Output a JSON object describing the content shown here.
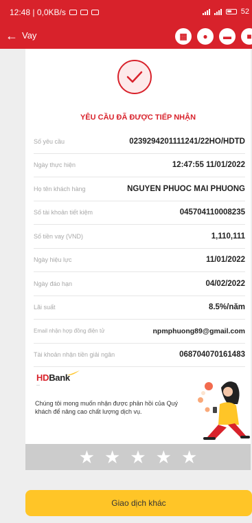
{
  "status_bar": {
    "time_speed": "12:48 | 0,0KB/s",
    "battery": "52"
  },
  "app_bar": {
    "back_icon": "arrow-left-icon",
    "title": "Vay",
    "icons": [
      "qr-icon",
      "bell-icon",
      "chat-icon",
      "gift-icon"
    ]
  },
  "success": {
    "title": "YÊU CẦU ĐÃ ĐƯỢC TIẾP NHẬN",
    "icon": "check-icon"
  },
  "details": [
    {
      "label": "Số yêu cầu",
      "value": "0239294201111241/22HO/HDTD"
    },
    {
      "label": "Ngày thực hiện",
      "value": "12:47:55 11/01/2022"
    },
    {
      "label": "Họ tên khách hàng",
      "value": "NGUYEN PHUOC MAI PHUONG"
    },
    {
      "label": "Số tài khoản tiết kiệm",
      "value": "045704110008235"
    },
    {
      "label": "Số tiền vay (VND)",
      "value": "1,110,111"
    },
    {
      "label": "Ngày hiệu lực",
      "value": "11/01/2022"
    },
    {
      "label": "Ngày đáo hạn",
      "value": "04/02/2022"
    },
    {
      "label": "Lãi suất",
      "value": "8.5%/năm"
    },
    {
      "label": "Email nhận hợp đồng điện tử",
      "value": "npmphuong89@gmail.com"
    },
    {
      "label": "Tài khoản nhận tiền giải ngân",
      "value": "068704070161483"
    }
  ],
  "brand": {
    "logo": "HDBank",
    "colors": {
      "primary": "#d8222b",
      "accent": "#ffc527"
    }
  },
  "feedback": {
    "text": "Chúng tôi mong muốn nhận được phản hồi của Quý khách để nâng cao chất lượng dịch vụ.",
    "rating_max": 5,
    "rating_value": 0
  },
  "cta": {
    "label": "Giao dịch khác"
  }
}
